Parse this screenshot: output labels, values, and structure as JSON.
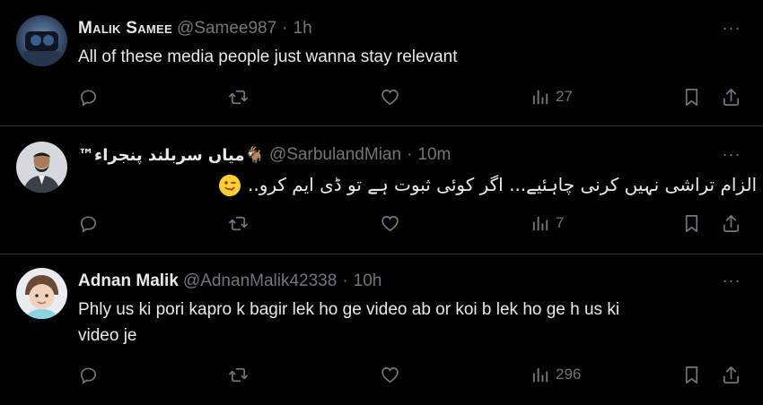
{
  "colors": {
    "background": "#000000",
    "text_primary": "#e7e9ea",
    "text_secondary": "#71767b",
    "divider": "#2f3336"
  },
  "tweets": [
    {
      "name": "Malik Samee",
      "handle": "@Samee987",
      "separator": "·",
      "time": "1h",
      "text": "All of these media people just wanna stay relevant",
      "more": "···",
      "stats": {
        "replies": "",
        "retweets": "",
        "likes": "",
        "views": "27"
      },
      "icons": [
        "reply-icon",
        "retweet-icon",
        "like-icon",
        "views-icon",
        "bookmark-icon",
        "share-icon"
      ]
    },
    {
      "name": "میاں سربلند پنجراء™‏🐐",
      "handle": "@SarbulandMian",
      "separator": "·",
      "time": "10m",
      "text": "الزام تراشی نہیں کرنی چاہئیے... اگر کوئی ثبوت ہے تو ڈی ایم کرو..",
      "emoji": "winking-face-with-tongue",
      "more": "···",
      "stats": {
        "replies": "",
        "retweets": "",
        "likes": "",
        "views": "7"
      },
      "icons": [
        "reply-icon",
        "retweet-icon",
        "like-icon",
        "views-icon",
        "bookmark-icon",
        "share-icon"
      ]
    },
    {
      "name": "Adnan Malik",
      "handle": "@AdnanMalik42338",
      "separator": "·",
      "time": "10h",
      "text_line1": "Phly us ki pori kapro k bagir lek ho ge video ab or koi b lek ho ge h us ki",
      "text_line2": "video je",
      "more": "···",
      "stats": {
        "replies": "",
        "retweets": "",
        "likes": "",
        "views": "296"
      },
      "icons": [
        "reply-icon",
        "retweet-icon",
        "like-icon",
        "views-icon",
        "bookmark-icon",
        "share-icon"
      ]
    }
  ]
}
